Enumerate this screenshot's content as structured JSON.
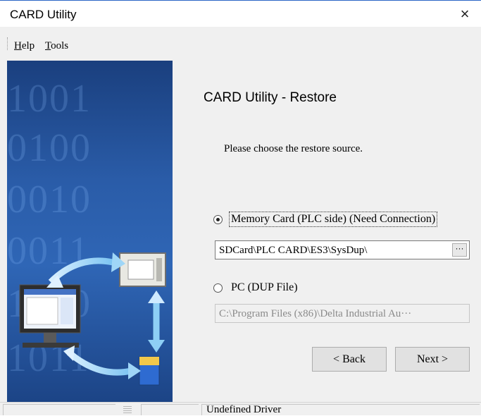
{
  "window": {
    "title": "CARD Utility",
    "close_glyph": "×"
  },
  "menu": {
    "items": [
      {
        "accel": "H",
        "rest": "elp"
      },
      {
        "accel": "T",
        "rest": "ools"
      }
    ]
  },
  "side_panel": {
    "background_digits": [
      "1001",
      "0100",
      "0010",
      "0011",
      "1010",
      "1011"
    ]
  },
  "main": {
    "heading": "CARD Utility - Restore",
    "instruction": "Please choose the restore source.",
    "options": [
      {
        "label": "Memory Card (PLC side) (Need Connection)",
        "selected": true,
        "path": "SDCard\\PLC CARD\\ES3\\SysDup\\",
        "browse_label": "···",
        "enabled": true
      },
      {
        "label": "PC (DUP File)",
        "selected": false,
        "path": "C:\\Program Files (x86)\\Delta Industrial Au···",
        "browse_label": "···",
        "enabled": false
      }
    ]
  },
  "buttons": {
    "back": "< Back",
    "next": "Next >"
  },
  "statusbar": {
    "driver": "Undefined Driver"
  },
  "colors": {
    "panel_blue": "#2a5ca8",
    "title_border": "#2b66c6"
  },
  "icons": {
    "close": "close-icon",
    "status": "grip-icon"
  }
}
